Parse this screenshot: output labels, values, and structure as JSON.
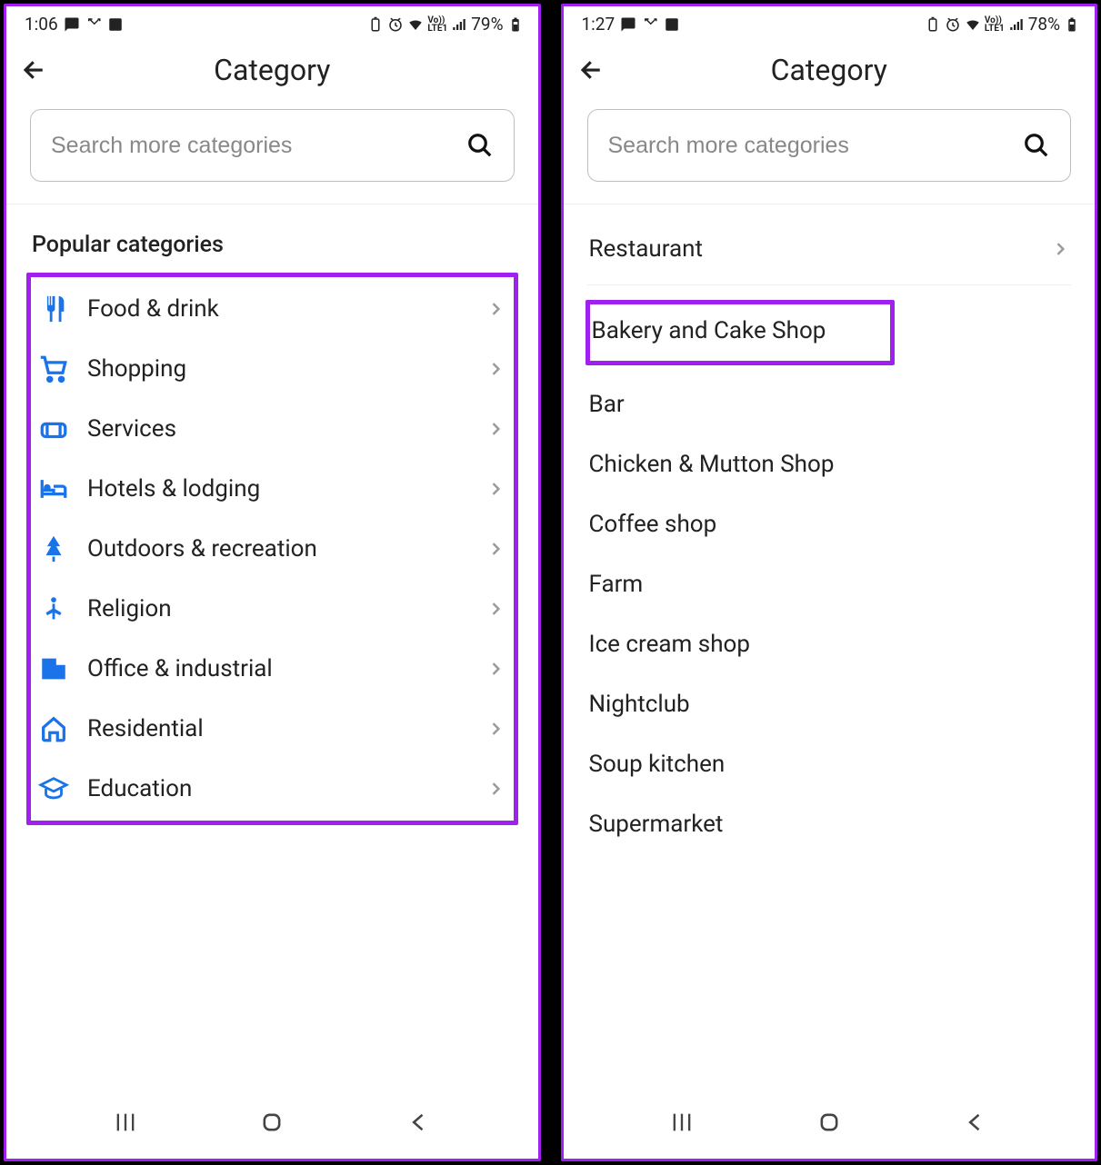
{
  "left": {
    "statusbar": {
      "time": "1:06",
      "battery": "79%"
    },
    "title": "Category",
    "search_placeholder": "Search more categories",
    "section_title": "Popular categories",
    "categories": [
      {
        "icon": "food-drink-icon",
        "label": "Food & drink"
      },
      {
        "icon": "shopping-icon",
        "label": "Shopping"
      },
      {
        "icon": "services-icon",
        "label": "Services"
      },
      {
        "icon": "hotel-icon",
        "label": "Hotels & lodging"
      },
      {
        "icon": "outdoors-icon",
        "label": "Outdoors & recreation"
      },
      {
        "icon": "religion-icon",
        "label": "Religion"
      },
      {
        "icon": "office-icon",
        "label": "Office & industrial"
      },
      {
        "icon": "residential-icon",
        "label": "Residential"
      },
      {
        "icon": "education-icon",
        "label": "Education"
      }
    ]
  },
  "right": {
    "statusbar": {
      "time": "1:27",
      "battery": "78%"
    },
    "title": "Category",
    "search_placeholder": "Search more categories",
    "parent": "Restaurant",
    "highlighted": "Bakery and Cake Shop",
    "subcategories": [
      "Bar",
      "Chicken & Mutton Shop",
      "Coffee shop",
      "Farm",
      "Ice cream shop",
      "Nightclub",
      "Soup kitchen",
      "Supermarket"
    ]
  }
}
